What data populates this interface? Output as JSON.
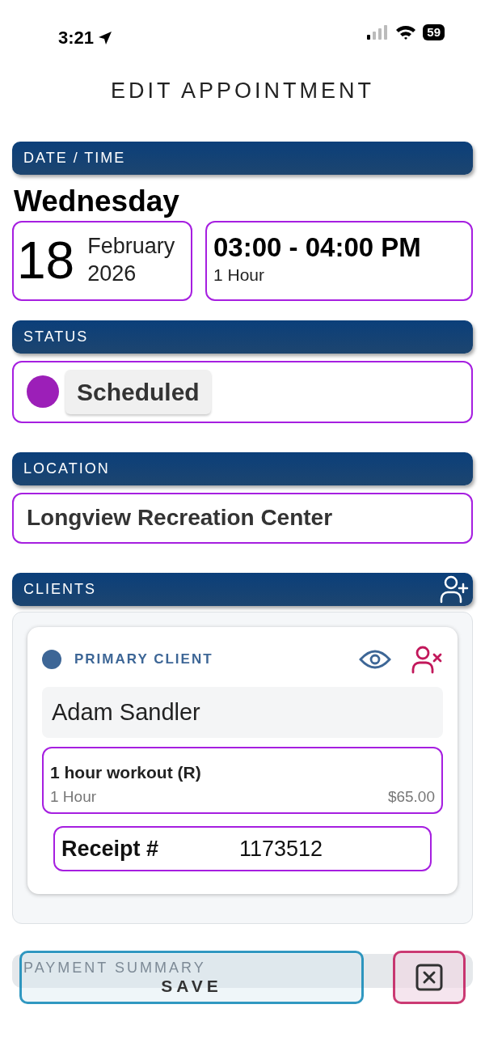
{
  "status_bar": {
    "time": "3:21",
    "battery": "59"
  },
  "title": "EDIT APPOINTMENT",
  "date_time": {
    "header": "DATE / TIME",
    "weekday": "Wednesday",
    "day": "18",
    "month": "February",
    "year": "2026",
    "time_range": "03:00 - 04:00 PM",
    "duration": "1 Hour"
  },
  "status": {
    "header": "STATUS",
    "label": "Scheduled"
  },
  "location": {
    "header": "LOCATION",
    "value": "Longview Recreation Center"
  },
  "clients": {
    "header": "CLIENTS",
    "items": [
      {
        "role": "PRIMARY CLIENT",
        "name": "Adam Sandler",
        "service": {
          "name": "1 hour workout (R)",
          "duration": "1 Hour",
          "price": "$65.00"
        },
        "receipt_label": "Receipt #",
        "receipt": "1173512"
      }
    ]
  },
  "payment_summary": {
    "header": "PAYMENT SUMMARY"
  },
  "actions": {
    "save": "SAVE"
  }
}
